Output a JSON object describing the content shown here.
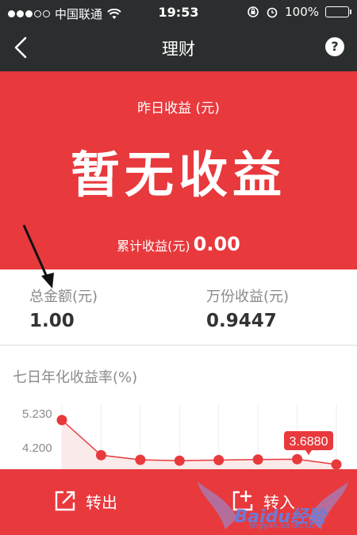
{
  "status_bar": {
    "carrier": "中国联通",
    "time": "19:53",
    "battery": "100%"
  },
  "nav": {
    "title": "理财",
    "help_label": "?"
  },
  "banner": {
    "yesterday_label": "昨日收益 (元)",
    "yesterday_value": "暂无收益",
    "cumulative_label": "累计收益(元)",
    "cumulative_value": "0.00"
  },
  "stats": {
    "total_label": "总金额(元)",
    "total_value": "1.00",
    "per10k_label": "万份收益(元)",
    "per10k_value": "0.9447"
  },
  "chart_data": {
    "type": "line",
    "title": "七日年化收益率(%)",
    "y_tick_labels": [
      "5.230",
      "4.200"
    ],
    "values": [
      5.23,
      4.01,
      3.85,
      3.82,
      3.84,
      3.86,
      3.87,
      3.688
    ],
    "highlight_label": "3.6880",
    "colors": {
      "line": "#e8393d",
      "highlight_bg": "#e8393d"
    }
  },
  "actions": {
    "transfer_out": "转出",
    "transfer_in": "转入"
  },
  "watermark": {
    "brand": "Baidu经验",
    "url": "jingyan.baidu.com"
  }
}
